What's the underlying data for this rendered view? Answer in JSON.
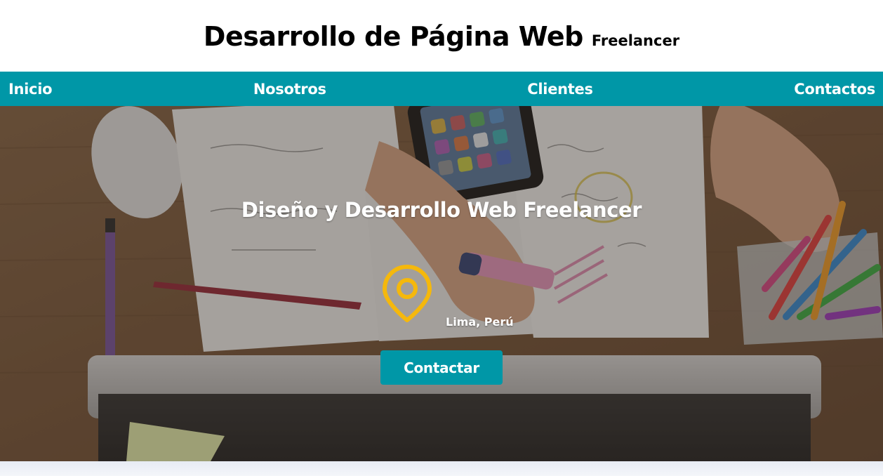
{
  "header": {
    "title": "Desarrollo de Página Web",
    "subtitle": "Freelancer"
  },
  "nav": {
    "items": [
      {
        "label": "Inicio"
      },
      {
        "label": "Nosotros"
      },
      {
        "label": "Clientes"
      },
      {
        "label": "Contactos"
      }
    ]
  },
  "hero": {
    "title": "Diseño y Desarrollo Web Freelancer",
    "location": "Lima, Perú",
    "location_icon": "map-pin-icon",
    "cta_label": "Contactar",
    "background": "desk-workspace-photo"
  },
  "colors": {
    "accent": "#0097a7",
    "pin": "#f5b80c",
    "header_bg": "#ffffff"
  }
}
